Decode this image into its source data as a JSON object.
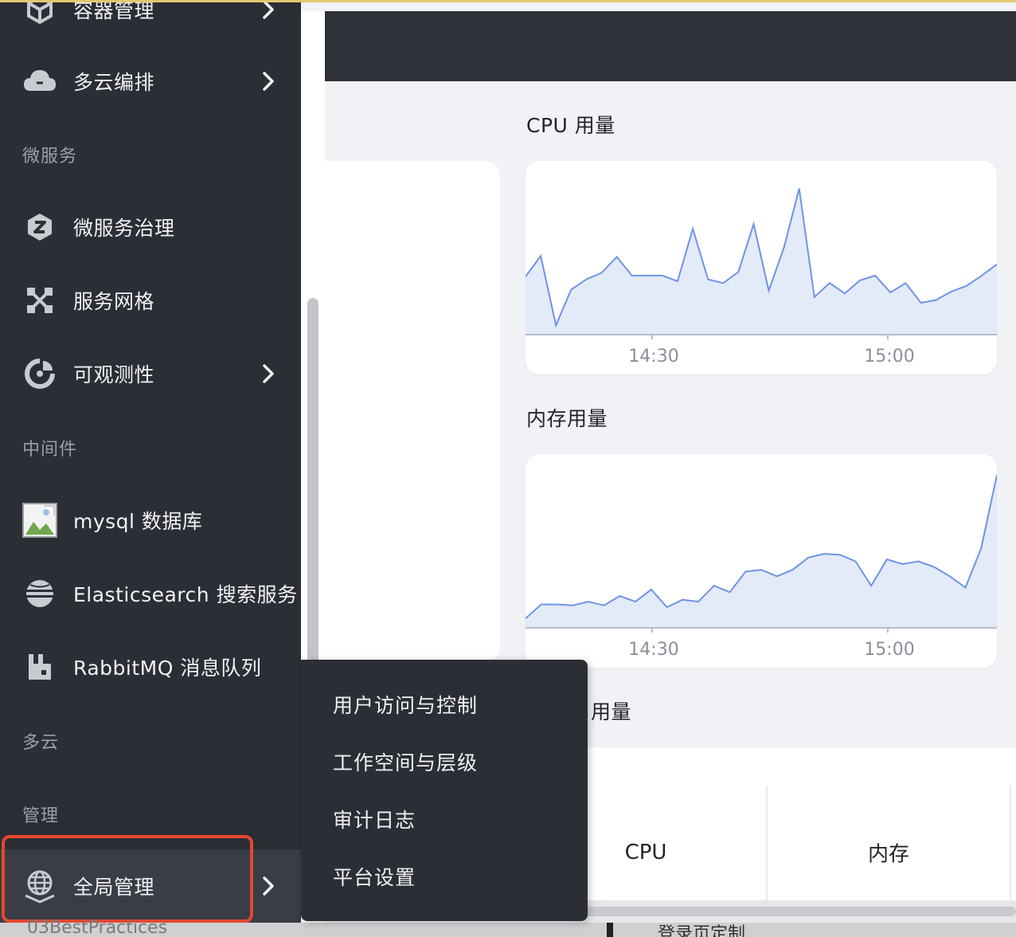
{
  "sidebar": {
    "top_partial": "容器管理",
    "items": [
      {
        "label": "多云编排",
        "icon": "cloud-icon"
      },
      {
        "label": "微服务治理",
        "icon": "microservice-icon"
      },
      {
        "label": "服务网格",
        "icon": "mesh-icon"
      },
      {
        "label": "可观测性",
        "icon": "observability-icon"
      },
      {
        "label": "mysql 数据库",
        "icon": "broken-image-icon"
      },
      {
        "label": "Elasticsearch 搜索服务",
        "icon": "elasticsearch-icon"
      },
      {
        "label": "RabbitMQ 消息队列",
        "icon": "rabbitmq-icon"
      },
      {
        "label": "全局管理",
        "icon": "globe-icon"
      }
    ],
    "sections": [
      "微服务",
      "中间件",
      "多云",
      "管理"
    ],
    "bottom_partial": "03BestPractices"
  },
  "flyout": {
    "items": [
      "用户访问与控制",
      "工作空间与层级",
      "审计日志",
      "平台设置"
    ]
  },
  "charts": {
    "cpu_title": "CPU 用量",
    "memory_title": "内存用量",
    "third_title_partial": "用量"
  },
  "table": {
    "headers": [
      "CPU",
      "内存"
    ]
  },
  "bottom_partial_right": "登录页定制",
  "chart_data": [
    {
      "type": "area",
      "title": "CPU 用量",
      "x_ticks": [
        "14:30",
        "15:00"
      ],
      "y": [
        62,
        84,
        10,
        48,
        59,
        66,
        83,
        63,
        63,
        63,
        57,
        113,
        59,
        55,
        67,
        118,
        47,
        93,
        156,
        40,
        55,
        44,
        58,
        63,
        45,
        55,
        34,
        37,
        46,
        52,
        63,
        75
      ],
      "color": "#6e94e6"
    },
    {
      "type": "area",
      "title": "内存用量",
      "x_ticks": [
        "14:30",
        "15:00"
      ],
      "y": [
        10,
        25,
        25,
        24,
        28,
        24,
        34,
        28,
        41,
        22,
        30,
        28,
        45,
        38,
        60,
        62,
        55,
        62,
        75,
        79,
        78,
        71,
        45,
        73,
        68,
        71,
        65,
        55,
        43,
        85,
        163
      ],
      "color": "#6e94e6"
    }
  ]
}
